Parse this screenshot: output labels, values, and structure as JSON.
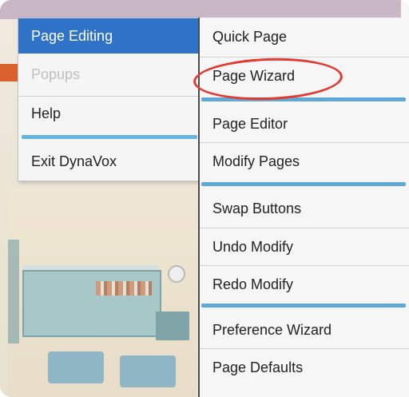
{
  "left_menu": {
    "items": [
      {
        "label": "Page Editing",
        "state": "active"
      },
      {
        "label": "Popups",
        "state": "disabled"
      },
      {
        "label": "Help",
        "state": "normal"
      },
      {
        "label": "Exit DynaVox",
        "state": "normal"
      }
    ]
  },
  "submenu": {
    "items": [
      {
        "label": "Quick Page"
      },
      {
        "label": "Page Wizard",
        "annotated": true
      },
      {
        "label": "Page Editor"
      },
      {
        "label": "Modify Pages"
      },
      {
        "label": "Swap Buttons"
      },
      {
        "label": "Undo Modify"
      },
      {
        "label": "Redo Modify"
      },
      {
        "label": "Preference Wizard"
      },
      {
        "label": "Page Defaults"
      }
    ]
  },
  "colors": {
    "active_bg": "#2f73c9",
    "separator_blue": "#66b3dc",
    "annotation_red": "#e23a30"
  }
}
